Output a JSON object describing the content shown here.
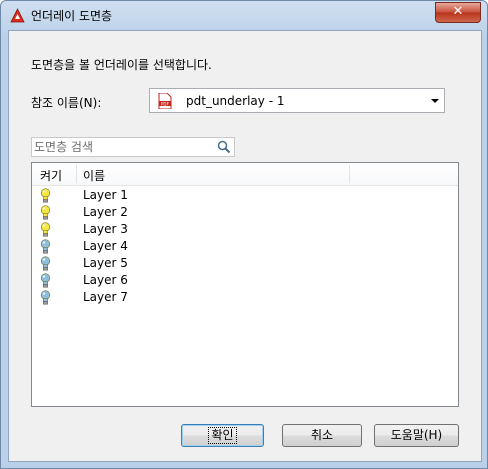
{
  "window": {
    "title": "언더레이 도면층",
    "close_label": "✕"
  },
  "prompt": "도면층을 볼 언더레이를 선택합니다.",
  "reference": {
    "label": "참조 이름(N):",
    "value": "pdt_underlay - 1"
  },
  "search": {
    "placeholder": "도면층 검색",
    "value": ""
  },
  "table": {
    "columns": [
      "켜기",
      "이름"
    ],
    "rows": [
      {
        "name": "Layer 1",
        "on": true
      },
      {
        "name": "Layer 2",
        "on": true
      },
      {
        "name": "Layer 3",
        "on": true
      },
      {
        "name": "Layer 4",
        "on": false
      },
      {
        "name": "Layer 5",
        "on": false
      },
      {
        "name": "Layer 6",
        "on": false
      },
      {
        "name": "Layer 7",
        "on": false
      }
    ]
  },
  "buttons": {
    "ok": "확인",
    "cancel": "취소",
    "help": "도움말(H)"
  },
  "icons": {
    "app": "autocad-icon",
    "file": "pdf-file-icon",
    "search": "search-icon",
    "bulb_on": "lightbulb-on-icon",
    "bulb_off": "lightbulb-off-icon"
  },
  "colors": {
    "bulb_on": "#f5e642",
    "bulb_off": "#8fbedd",
    "close": "#c7503b"
  }
}
